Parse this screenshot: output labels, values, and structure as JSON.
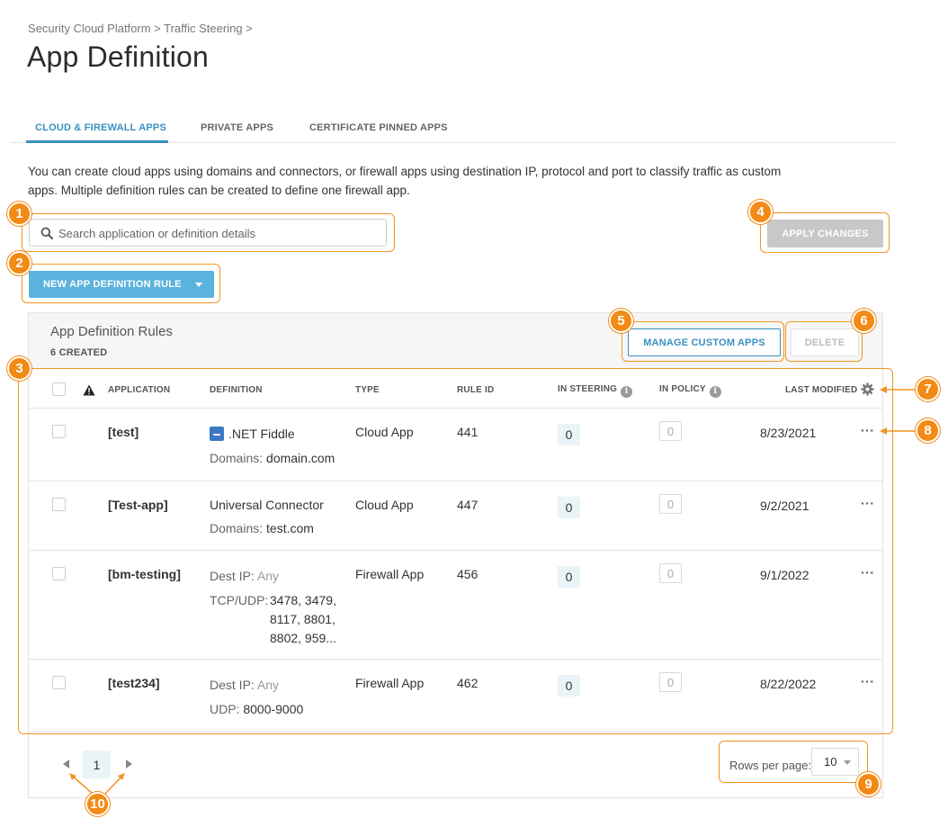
{
  "breadcrumb": "Security Cloud Platform > Traffic Steering >",
  "page_title": "App Definition",
  "tabs": [
    {
      "label": "CLOUD & FIREWALL APPS",
      "active": true
    },
    {
      "label": "PRIVATE APPS",
      "active": false
    },
    {
      "label": "CERTIFICATE PINNED APPS",
      "active": false
    }
  ],
  "intro": "You can create cloud apps using domains and connectors, or firewall apps using destination IP, protocol and port to classify traffic as custom apps. Multiple definition rules can be created to define one firewall app.",
  "search": {
    "placeholder": "Search application or definition details",
    "value": ""
  },
  "apply_changes_label": "APPLY CHANGES",
  "new_rule_label": "NEW APP DEFINITION RULE",
  "panel": {
    "title": "App Definition Rules",
    "subtitle": "6 CREATED",
    "manage_label": "MANAGE CUSTOM APPS",
    "delete_label": "DELETE"
  },
  "columns": {
    "application": "APPLICATION",
    "definition": "DEFINITION",
    "type": "TYPE",
    "rule_id": "RULE ID",
    "in_steering": "IN STEERING",
    "in_policy": "IN POLICY",
    "last_modified": "LAST MODIFIED"
  },
  "rows": [
    {
      "application": "[test]",
      "def_line1": ".NET Fiddle",
      "def_label2": "Domains:",
      "def_value2": "domain.com",
      "type": "Cloud App",
      "rule_id": "441",
      "in_steering": "0",
      "in_policy": "0",
      "last_modified": "8/23/2021",
      "more": "···"
    },
    {
      "application": "[Test-app]",
      "def_line1": "Universal Connector",
      "def_label2": "Domains:",
      "def_value2": "test.com",
      "type": "Cloud App",
      "rule_id": "447",
      "in_steering": "0",
      "in_policy": "0",
      "last_modified": "9/2/2021",
      "more": "···"
    },
    {
      "application": "[bm-testing]",
      "def_label1": "Dest IP:",
      "def_value1": "Any",
      "def_label2": "TCP/UDP:",
      "def_value2_lines": [
        "3478, 3479,",
        "8117, 8801,",
        "8802, 959..."
      ],
      "type": "Firewall App",
      "rule_id": "456",
      "in_steering": "0",
      "in_policy": "0",
      "last_modified": "9/1/2022",
      "more": "···"
    },
    {
      "application": "[test234]",
      "def_label1": "Dest IP:",
      "def_value1": "Any",
      "def_label2": "UDP:",
      "def_value2": "8000-9000",
      "type": "Firewall App",
      "rule_id": "462",
      "in_steering": "0",
      "in_policy": "0",
      "last_modified": "8/22/2022",
      "more": "···"
    }
  ],
  "pagination": {
    "current_page": "1",
    "rows_per_page_label": "Rows per page:",
    "rows_per_page_value": "10"
  },
  "callouts": [
    "1",
    "2",
    "3",
    "4",
    "5",
    "6",
    "7",
    "8",
    "9",
    "10"
  ],
  "colors": {
    "accent": "#3a8fc1",
    "primary_button": "#5ab3dc",
    "callout": "#f28a16"
  },
  "icons": {
    "search": "search-icon",
    "warning": "warning-icon",
    "settings": "gear-icon",
    "info": "info-icon",
    "app": "dotnet-fiddle-icon"
  }
}
